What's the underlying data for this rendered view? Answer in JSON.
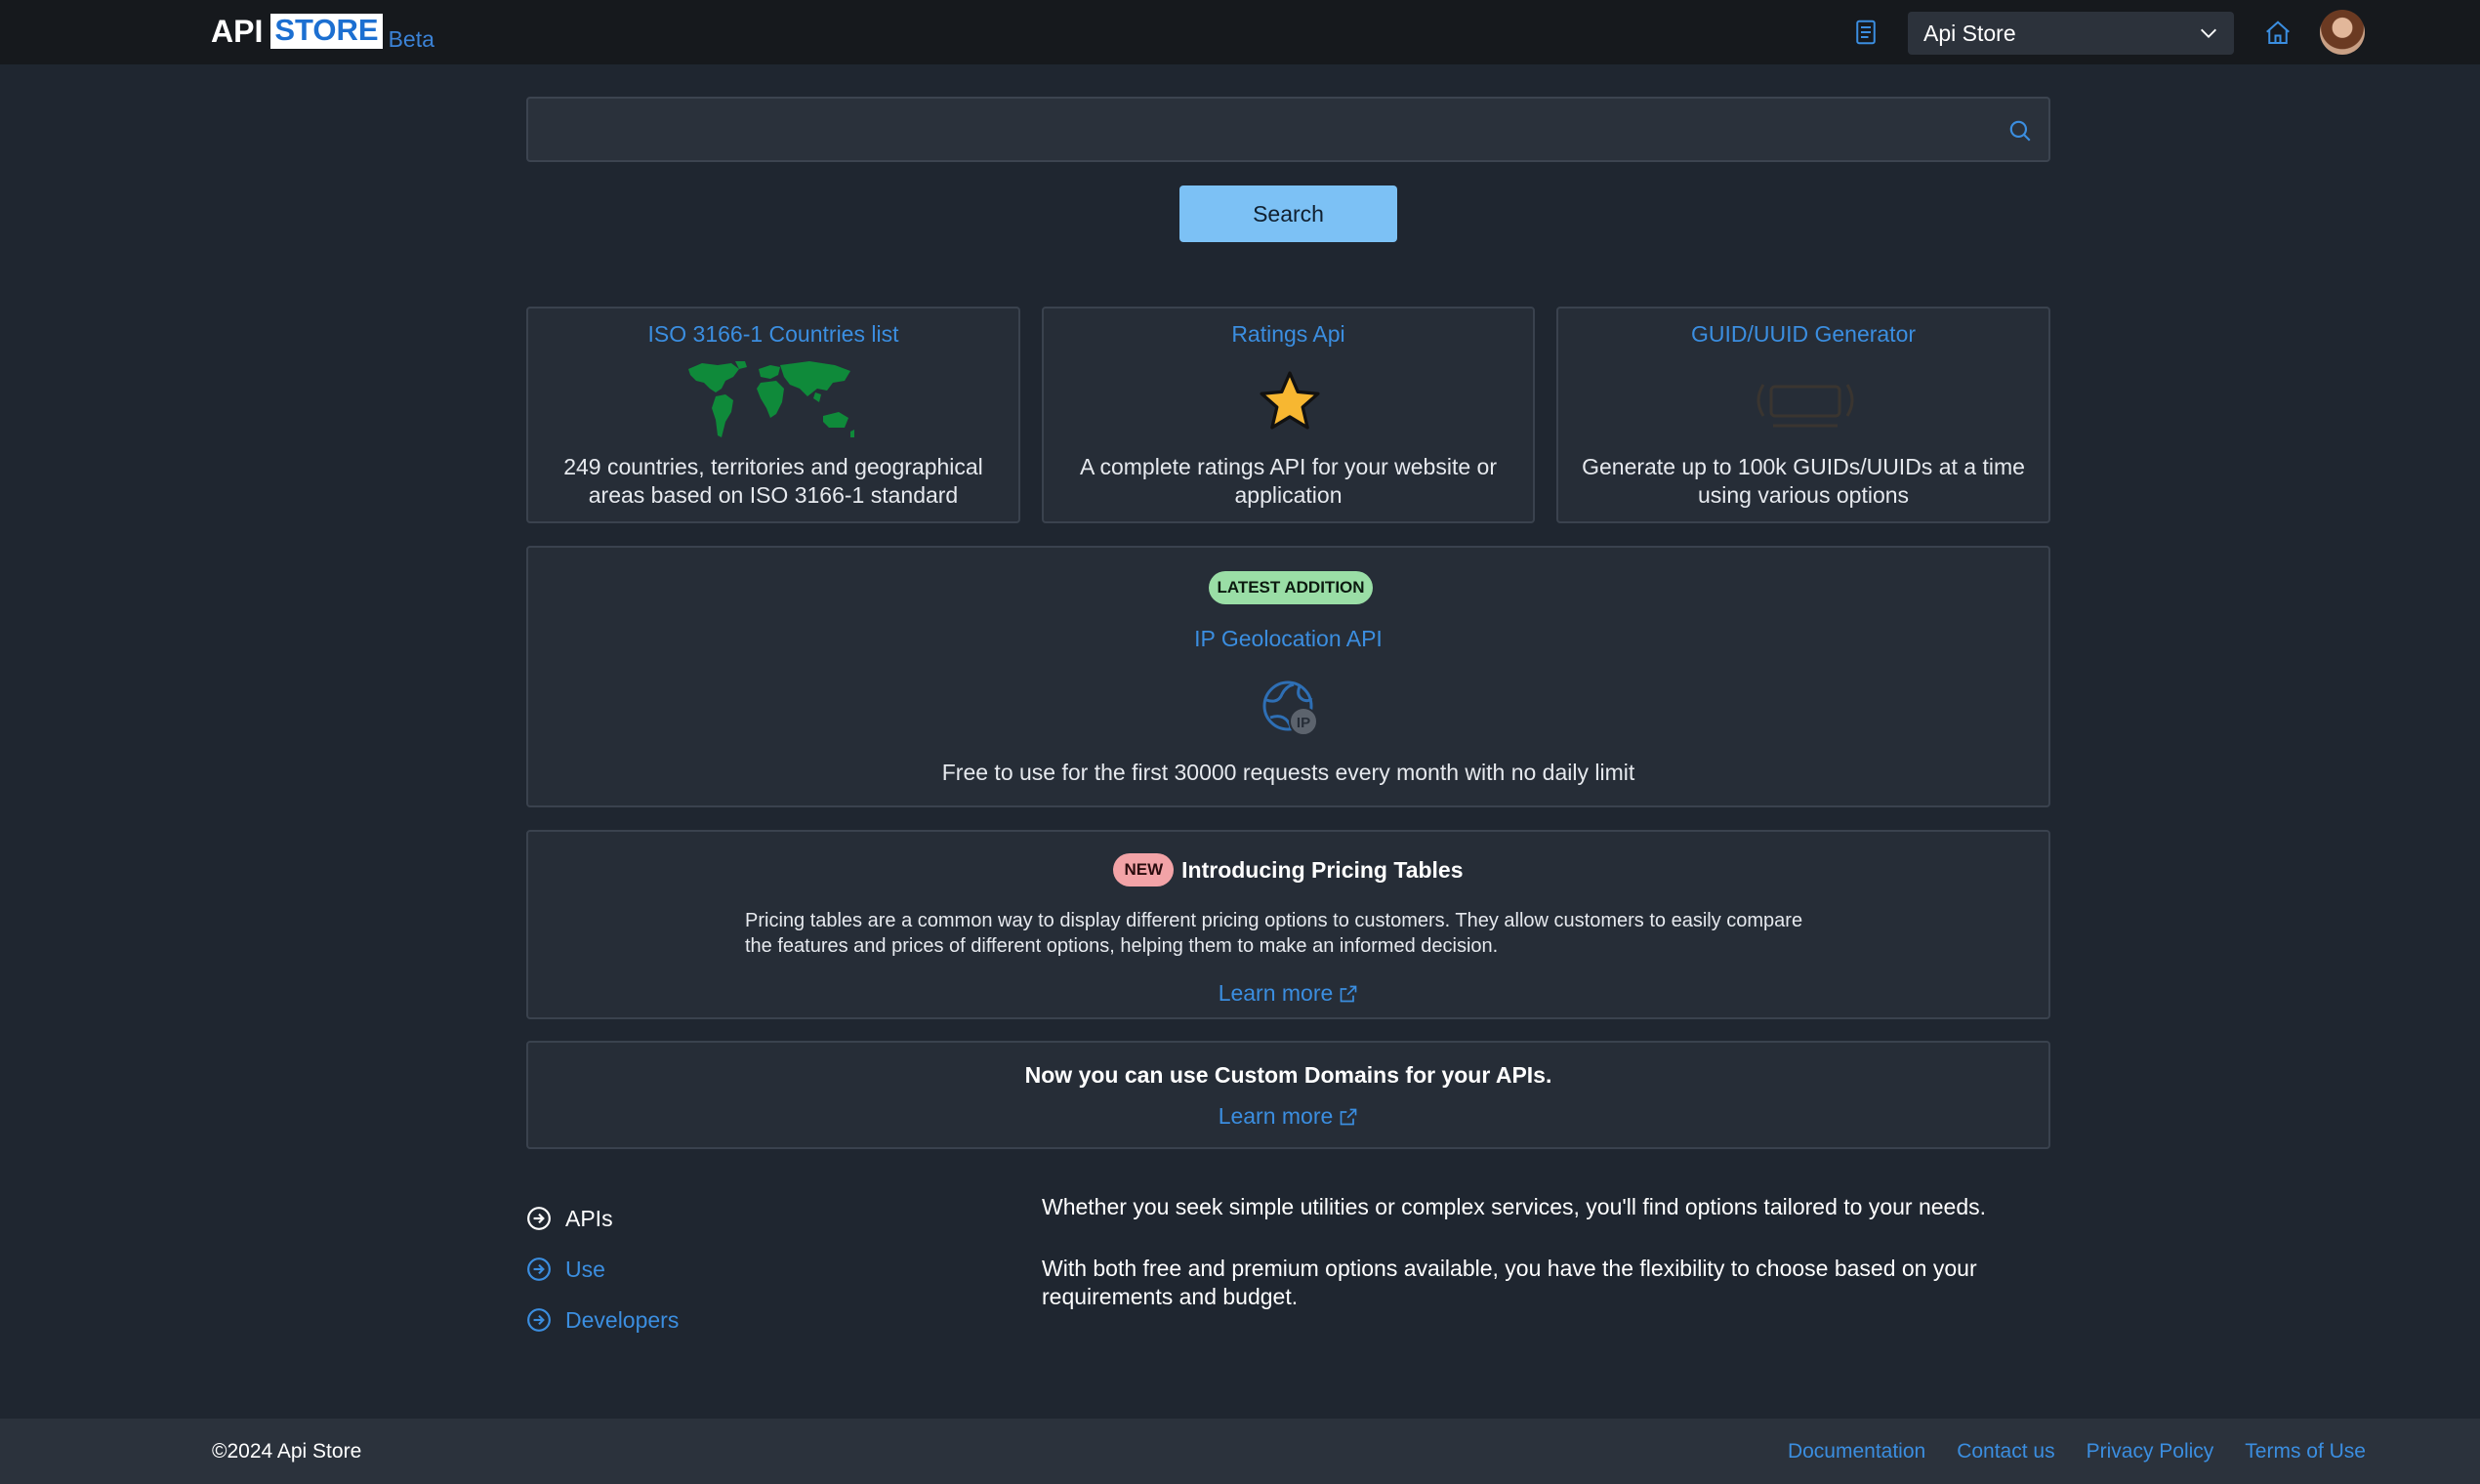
{
  "header": {
    "logo_api": "API",
    "logo_store": "STORE",
    "logo_beta": "Beta",
    "selected_store": "Api Store"
  },
  "search": {
    "value": "",
    "placeholder": "",
    "button_label": "Search"
  },
  "cards": [
    {
      "title": "ISO 3166-1 Countries list",
      "description": "249 countries, territories and geographical areas based on ISO 3166-1 standard",
      "icon": "world-map-icon"
    },
    {
      "title": "Ratings Api",
      "description": "A complete ratings API for your website or application",
      "icon": "star-icon"
    },
    {
      "title": "GUID/UUID Generator",
      "description": "Generate up to 100k GUIDs/UUIDs at a time using various options",
      "icon": "uuid-icon"
    }
  ],
  "latest": {
    "badge": "LATEST ADDITION",
    "title": "IP Geolocation API",
    "description": "Free to use for the first 30000 requests every month with no daily limit",
    "icon": "ip-globe-icon"
  },
  "pricing": {
    "badge": "NEW",
    "title": "Introducing Pricing Tables",
    "description": "Pricing tables are a common way to display different pricing options to customers. They allow customers to easily compare the features and prices of different options, helping them to make an informed decision.",
    "link": "Learn more"
  },
  "custom_domains": {
    "title": "Now you can use Custom Domains for your APIs.",
    "link": "Learn more"
  },
  "nav": [
    {
      "label": "APIs",
      "active": true
    },
    {
      "label": "Use",
      "active": false
    },
    {
      "label": "Developers",
      "active": false
    }
  ],
  "info": {
    "p1": "Whether you seek simple utilities or complex services, you'll find options tailored to your needs.",
    "p2": "With both free and premium options available, you have the flexibility to choose based on your requirements and budget."
  },
  "footer": {
    "copyright": "©2024 Api Store",
    "links": [
      "Documentation",
      "Contact us",
      "Privacy Policy",
      "Terms of Use"
    ]
  },
  "colors": {
    "background": "#1f2630",
    "topbar": "#16191d",
    "accent_link": "#3b8ee0",
    "search_button": "#7cc1f5",
    "badge_latest": "#9adea6",
    "badge_new": "#f2a3a7",
    "map_green": "#0f8a3a",
    "star_gold": "#f7b731"
  }
}
